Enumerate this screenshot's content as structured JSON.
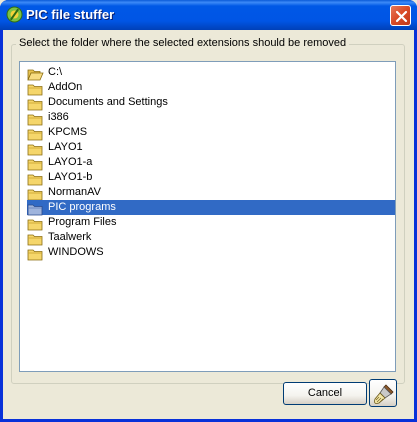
{
  "window": {
    "title": "PIC file stuffer",
    "app_icon": "pic-app-icon",
    "close_icon": "close-icon"
  },
  "group": {
    "label": "Select the folder where the selected extensions should be removed"
  },
  "tree": {
    "root": {
      "label": "C:\\",
      "icon": "open-folder-icon"
    },
    "items": [
      {
        "label": "AddOn",
        "icon": "folder-icon",
        "selected": false
      },
      {
        "label": "Documents and Settings",
        "icon": "folder-icon",
        "selected": false
      },
      {
        "label": "i386",
        "icon": "folder-icon",
        "selected": false
      },
      {
        "label": "KPCMS",
        "icon": "folder-icon",
        "selected": false
      },
      {
        "label": "LAYO1",
        "icon": "folder-icon",
        "selected": false
      },
      {
        "label": "LAYO1-a",
        "icon": "folder-icon",
        "selected": false
      },
      {
        "label": "LAYO1-b",
        "icon": "folder-icon",
        "selected": false
      },
      {
        "label": "NormanAV",
        "icon": "folder-icon",
        "selected": false
      },
      {
        "label": "PIC programs",
        "icon": "folder-icon",
        "selected": true
      },
      {
        "label": "Program Files",
        "icon": "folder-icon",
        "selected": false
      },
      {
        "label": "Taalwerk",
        "icon": "folder-icon",
        "selected": false
      },
      {
        "label": "WINDOWS",
        "icon": "folder-icon",
        "selected": false
      }
    ]
  },
  "buttons": {
    "cancel_label": "Cancel",
    "clean_icon": "brush-icon"
  },
  "colors": {
    "selection": "#316ac5",
    "titlebar": "#0055e5",
    "folder": "#f5d66b"
  }
}
